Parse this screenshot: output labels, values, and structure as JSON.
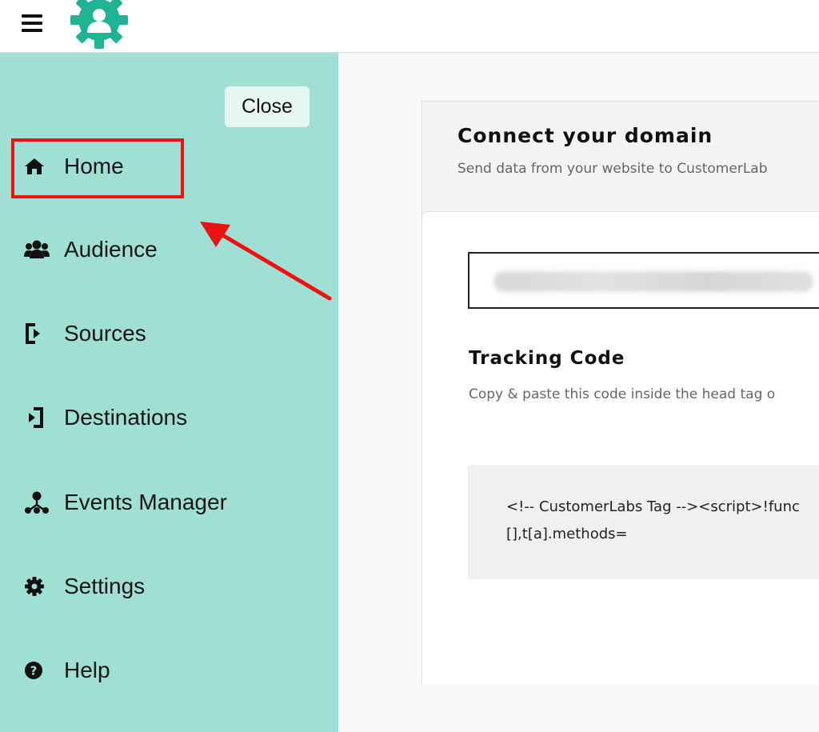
{
  "topbar": {
    "menu_icon": "hamburger-icon",
    "logo_icon": "gear-user-logo-icon"
  },
  "sidebar": {
    "close_label": "Close",
    "items": [
      {
        "label": "Home",
        "icon": "home-icon"
      },
      {
        "label": "Audience",
        "icon": "users-icon"
      },
      {
        "label": "Sources",
        "icon": "sources-icon"
      },
      {
        "label": "Destinations",
        "icon": "destinations-icon"
      },
      {
        "label": "Events Manager",
        "icon": "events-manager-icon"
      },
      {
        "label": "Settings",
        "icon": "gear-icon"
      },
      {
        "label": "Help",
        "icon": "help-icon"
      }
    ]
  },
  "main": {
    "card_title": "Connect your domain",
    "card_subtitle": "Send data from your website to CustomerLab",
    "tracking_title": "Tracking Code",
    "tracking_subtitle": "Copy & paste this code inside the head tag o",
    "code_lines": [
      "<!-- CustomerLabs Tag --><script>!func",
      "[],t[a].methods="
    ]
  },
  "colors": {
    "sidebar_bg": "#a0dfd3",
    "logo": "#20b394",
    "highlight": "#ee1111",
    "close_bg": "#e7f6f2"
  }
}
